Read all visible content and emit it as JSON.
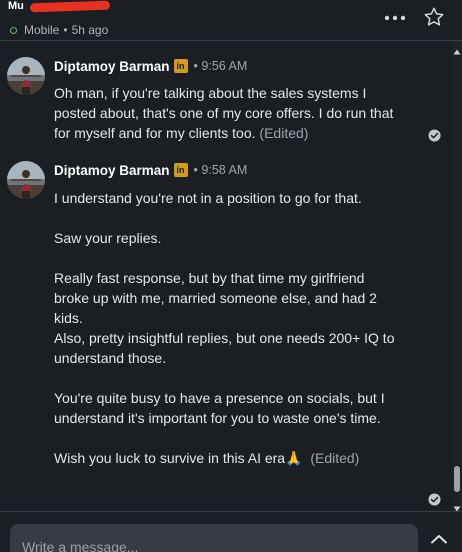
{
  "header": {
    "contact_name": "Mu",
    "presence_status": "Mobile",
    "presence_separator": "•",
    "presence_time": "5h ago"
  },
  "messages": [
    {
      "sender": "Diptamoy Barman",
      "badge": "in",
      "separator": "•",
      "time": "9:56 AM",
      "paragraphs": [
        "Oh man, if you're talking about the sales systems I posted about, that's one of my core offers. I do run that for myself and for my clients too."
      ],
      "edited_label": "(Edited)"
    },
    {
      "sender": "Diptamoy Barman",
      "badge": "in",
      "separator": "•",
      "time": "9:58 AM",
      "lines": [
        "I understand you're not in a position to go for that.",
        "",
        "Saw your replies.",
        "",
        "Really fast response, but by that time my girlfriend broke up with me, married someone else, and had 2 kids.",
        "Also, pretty insightful replies, but one needs 200+ IQ to understand those.",
        "",
        "You're quite busy to have a presence on socials, but I understand it's important for you to waste one's time.",
        "",
        "Wish you luck to survive in this AI era"
      ],
      "emoji": "🙏",
      "edited_label": "(Edited)"
    }
  ],
  "composer": {
    "placeholder": "Write a message..."
  },
  "icons": {
    "more": "more-icon",
    "star": "star-icon",
    "read": "check-circle-icon",
    "expand": "chevron-up-icon"
  },
  "colors": {
    "background": "#1b1f23",
    "online": "#5bbd78",
    "badge": "#d39b1c",
    "redaction": "#e8321f"
  }
}
